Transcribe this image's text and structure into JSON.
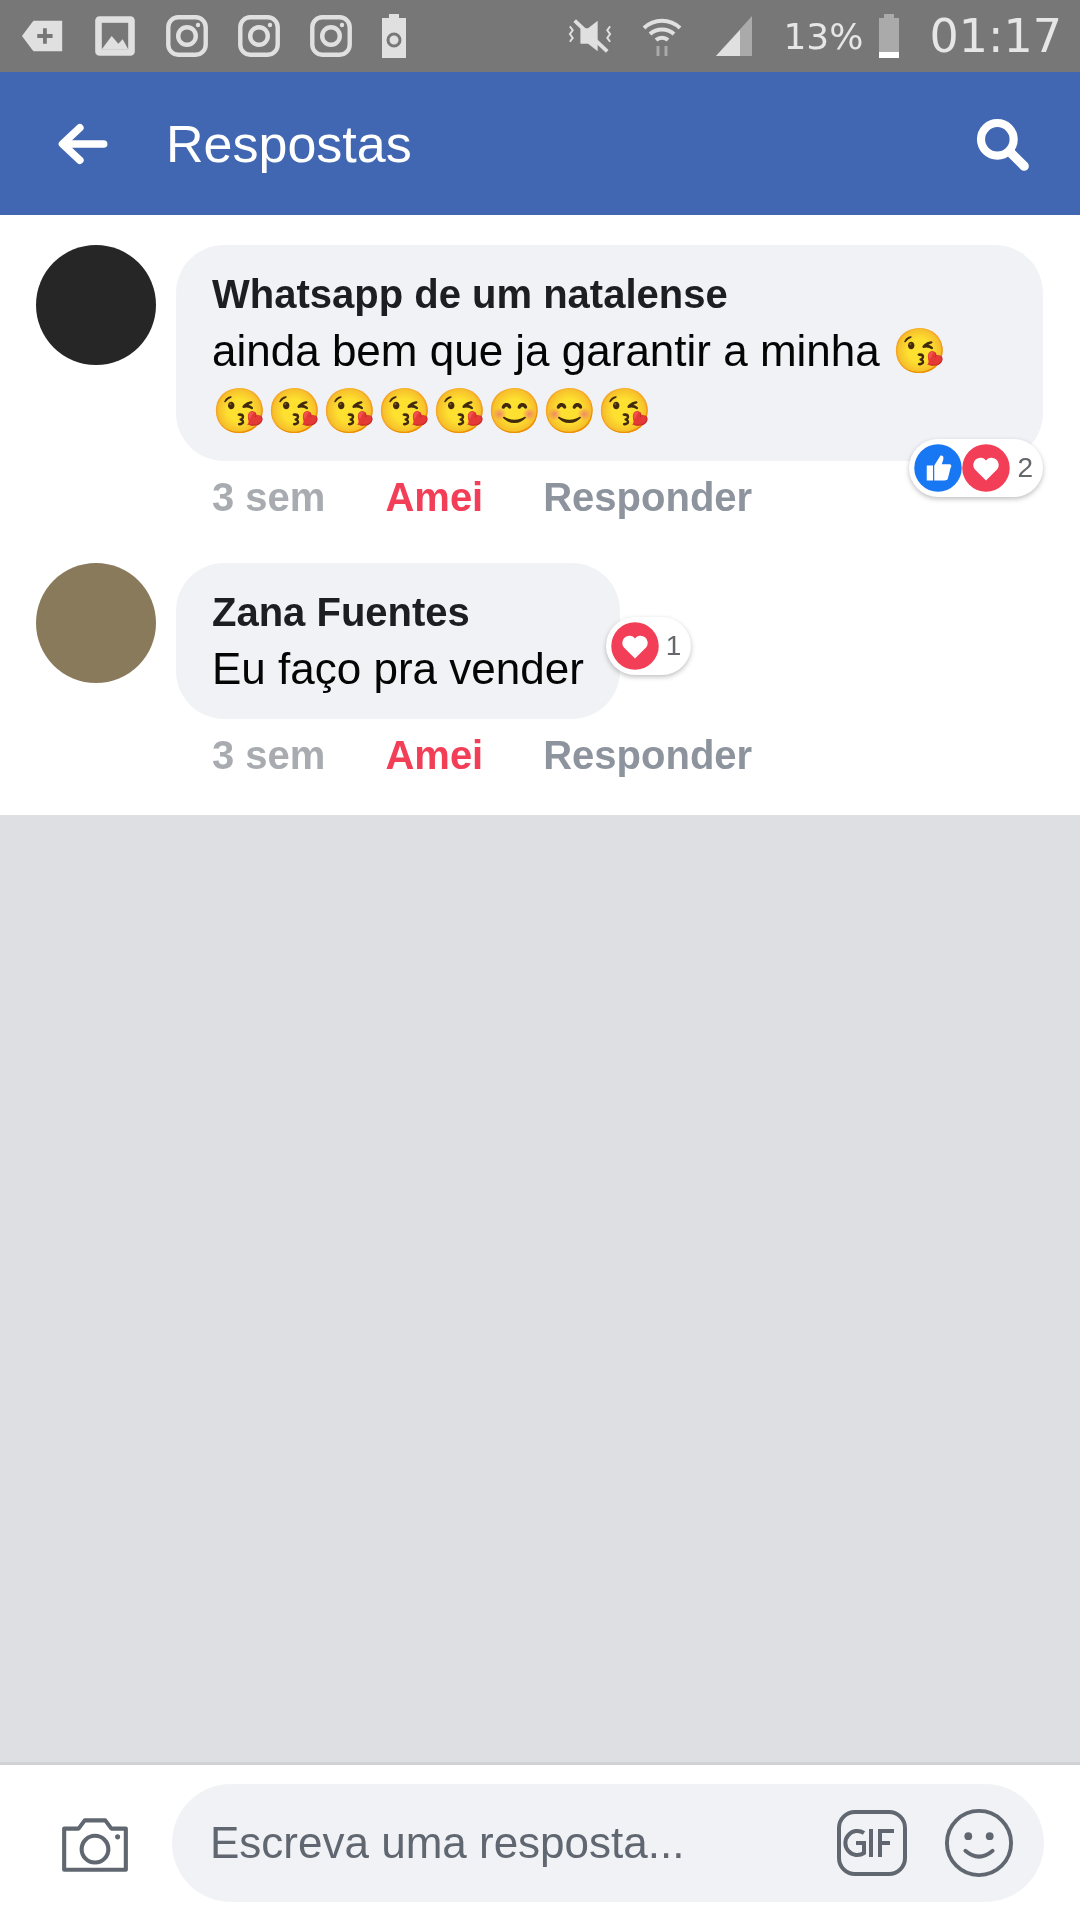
{
  "status_bar": {
    "battery": "13%",
    "time": "01:17"
  },
  "app_bar": {
    "title": "Respostas"
  },
  "comments": [
    {
      "avatar": {
        "kind": "logo"
      },
      "author": "Whatsapp de um natalense",
      "text": "ainda bem que ja garantir a minha 😘 😘😘😘😘😘😊😊😘",
      "time": "3 sem",
      "reaction_label": "Amei",
      "user_reacted": true,
      "reply_label": "Responder",
      "reactions": {
        "icons": [
          {
            "kind": "like"
          },
          {
            "kind": "love"
          }
        ],
        "count": "2"
      }
    },
    {
      "avatar": {
        "kind": "photo"
      },
      "author": "Zana Fuentes",
      "text": "Eu faço pra vender",
      "time": "3 sem",
      "reaction_label": "Amei",
      "user_reacted": true,
      "reply_label": "Responder",
      "reactions": {
        "icons": [
          {
            "kind": "love"
          }
        ],
        "count": "1"
      }
    }
  ],
  "composer": {
    "placeholder": "Escreva uma resposta..."
  }
}
